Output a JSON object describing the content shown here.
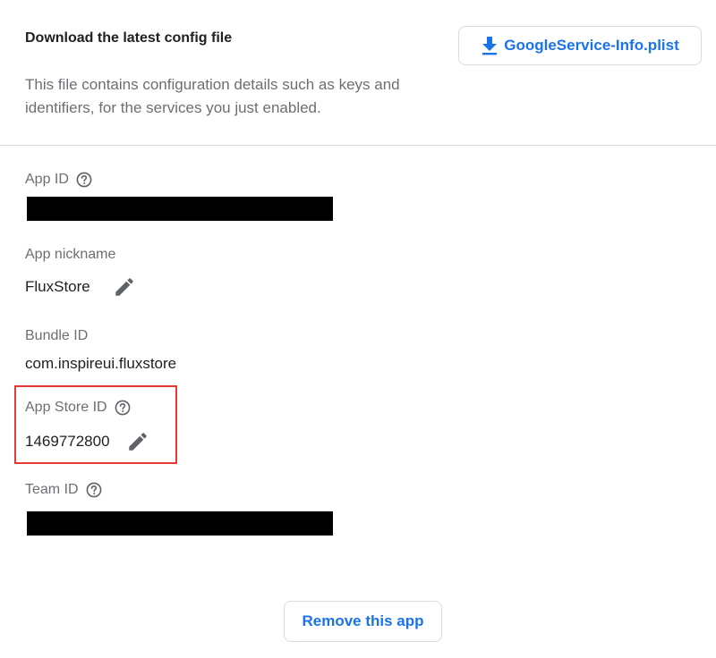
{
  "config": {
    "title": "Download the latest config file",
    "description": "This file contains configuration details such as keys and identifiers, for the services you just enabled.",
    "download_label": "GoogleService-Info.plist",
    "download_icon": "download-icon"
  },
  "fields": {
    "app_id": {
      "label": "App ID",
      "value_redacted": true
    },
    "app_nickname": {
      "label": "App nickname",
      "value": "FluxStore"
    },
    "bundle_id": {
      "label": "Bundle ID",
      "value": "com.inspireui.fluxstore"
    },
    "app_store_id": {
      "label": "App Store ID",
      "value": "1469772800"
    },
    "team_id": {
      "label": "Team ID",
      "value_redacted": true
    }
  },
  "actions": {
    "remove_label": "Remove this app"
  },
  "colors": {
    "accent": "#1a73e8",
    "highlight": "#e53935",
    "label": "#6b6f73",
    "text": "#202124",
    "border": "#dadce0"
  }
}
